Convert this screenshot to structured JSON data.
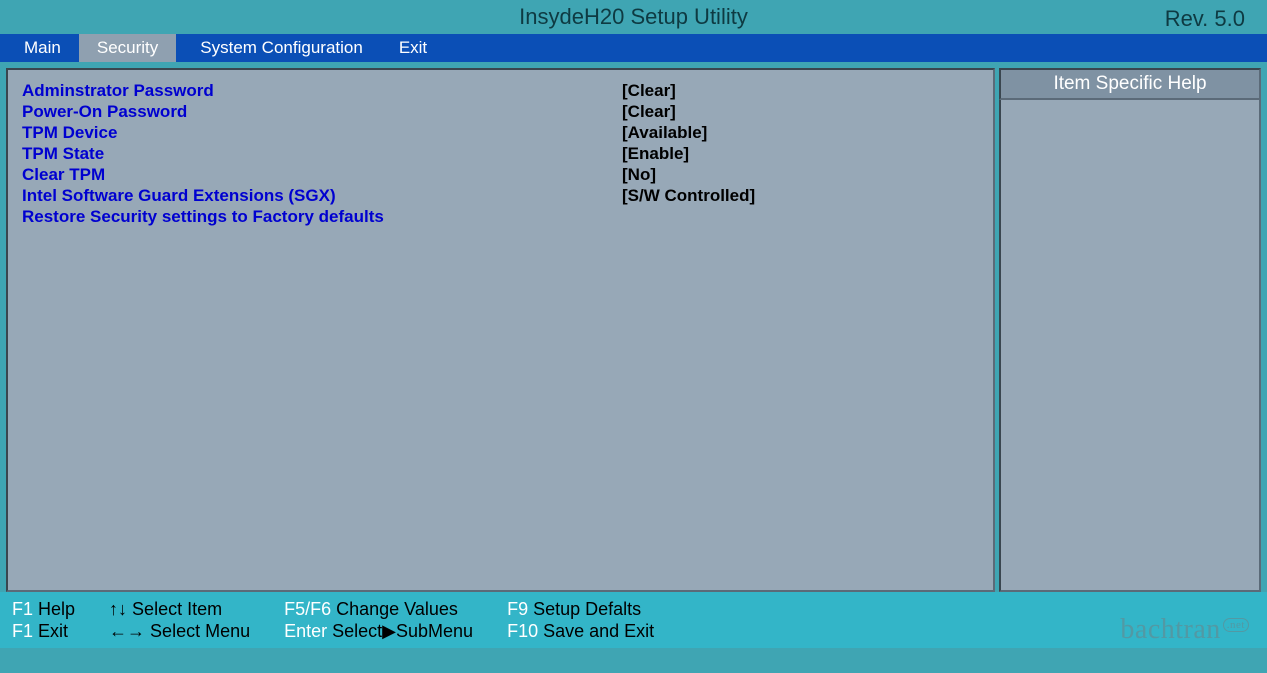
{
  "header": {
    "title": "InsydeH20 Setup Utility",
    "revision": "Rev. 5.0"
  },
  "tabs": {
    "main": "Main",
    "security": "Security",
    "system_configuration": "System Configuration",
    "exit": "Exit",
    "active": "security"
  },
  "settings": [
    {
      "label": "Adminstrator Password",
      "value": "[Clear]"
    },
    {
      "label": "Power-On Password",
      "value": "[Clear]"
    },
    {
      "label": "TPM Device",
      "value": "[Available]"
    },
    {
      "label": "TPM State",
      "value": "[Enable]"
    },
    {
      "label": "Clear TPM",
      "value": "[No]"
    },
    {
      "label": "Intel Software Guard Extensions (SGX)",
      "value": "[S/W Controlled]"
    },
    {
      "label": "Restore Security settings to Factory defaults",
      "value": ""
    }
  ],
  "help": {
    "title": "Item Specific Help"
  },
  "footer": {
    "f1_help_key": "F1",
    "f1_help_label": " Help",
    "f1_exit_key": "F1",
    "f1_exit_label": " Exit",
    "updown_arrows": "↑↓",
    "select_item": " Select Item",
    "leftright_arrows": "←→",
    "select_menu": " Select Menu",
    "f5f6_key": "F5/F6",
    "change_values": " Change Values",
    "enter_key": "Enter",
    "select_submenu": " Select▶SubMenu",
    "f9_key": "F9",
    "setup_defaults": " Setup Defalts",
    "f10_key": "F10",
    "save_exit": " Save and Exit"
  },
  "watermark": {
    "text": "bachtran",
    "suffix": ".net"
  }
}
